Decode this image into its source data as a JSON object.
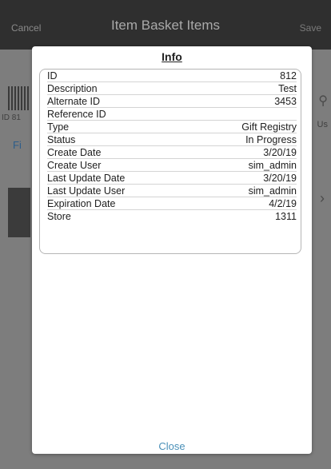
{
  "header": {
    "cancel_label": "Cancel",
    "title": "Item Basket Items",
    "save_label": "Save"
  },
  "background": {
    "id_text": "ID 81",
    "filter_text": "Fi",
    "units_text": "Us"
  },
  "modal": {
    "title": "Info",
    "rows": [
      {
        "label": "ID",
        "value": "812"
      },
      {
        "label": "Description",
        "value": "Test"
      },
      {
        "label": "Alternate ID",
        "value": "3453"
      },
      {
        "label": "Reference ID",
        "value": ""
      },
      {
        "label": "Type",
        "value": "Gift Registry"
      },
      {
        "label": "Status",
        "value": "In Progress"
      },
      {
        "label": "Create Date",
        "value": "3/20/19"
      },
      {
        "label": "Create User",
        "value": "sim_admin"
      },
      {
        "label": "Last Update Date",
        "value": "3/20/19"
      },
      {
        "label": "Last Update User",
        "value": "sim_admin"
      },
      {
        "label": "Expiration Date",
        "value": "4/2/19"
      },
      {
        "label": "Store",
        "value": "1311"
      }
    ],
    "close_label": "Close"
  },
  "icons": {
    "search": "search-icon",
    "chevron": "chevron-right-icon",
    "barcode": "barcode-icon"
  }
}
